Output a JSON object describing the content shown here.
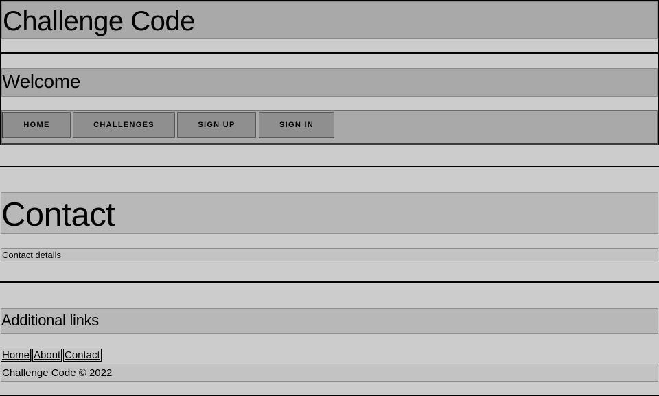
{
  "header": {
    "title": "Challenge Code"
  },
  "nav": {
    "heading": "Welcome",
    "items": [
      {
        "label": "HOME"
      },
      {
        "label": "CHALLENGES"
      },
      {
        "label": "SIGN UP"
      },
      {
        "label": "SIGN IN"
      }
    ]
  },
  "main": {
    "title": "Contact",
    "details": "Contact details"
  },
  "footer": {
    "heading": "Additional links",
    "links": [
      {
        "label": "Home"
      },
      {
        "label": "About"
      },
      {
        "label": "Contact"
      }
    ],
    "copyright": "Challenge Code © 2022"
  },
  "colors": {
    "page_background": "#cccccc",
    "header_band": "#a9a9a9",
    "nav_button": "#8f8f8f"
  }
}
